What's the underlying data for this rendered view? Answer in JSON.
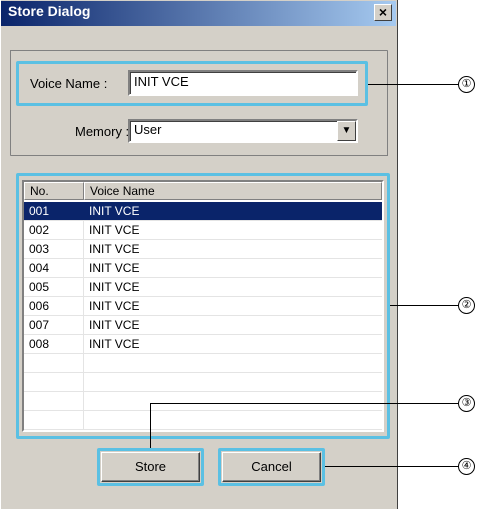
{
  "window": {
    "title": "Store Dialog"
  },
  "form": {
    "voice_name_label": "Voice Name :",
    "voice_name_value": "INIT VCE",
    "memory_label": "Memory :",
    "memory_value": "User"
  },
  "list": {
    "columns": [
      "No.",
      "Voice Name"
    ],
    "rows": [
      {
        "no": "001",
        "name": "INIT VCE",
        "selected": true
      },
      {
        "no": "002",
        "name": "INIT VCE"
      },
      {
        "no": "003",
        "name": "INIT VCE"
      },
      {
        "no": "004",
        "name": "INIT VCE"
      },
      {
        "no": "005",
        "name": "INIT VCE"
      },
      {
        "no": "006",
        "name": "INIT VCE"
      },
      {
        "no": "007",
        "name": "INIT VCE"
      },
      {
        "no": "008",
        "name": "INIT VCE"
      },
      {
        "no": "",
        "name": ""
      },
      {
        "no": "",
        "name": ""
      },
      {
        "no": "",
        "name": ""
      },
      {
        "no": "",
        "name": ""
      }
    ]
  },
  "buttons": {
    "store": "Store",
    "cancel": "Cancel"
  },
  "callouts": [
    "①",
    "②",
    "③",
    "④"
  ],
  "colors": {
    "highlight": "#5bc0e3",
    "selection": "#0a246a"
  }
}
